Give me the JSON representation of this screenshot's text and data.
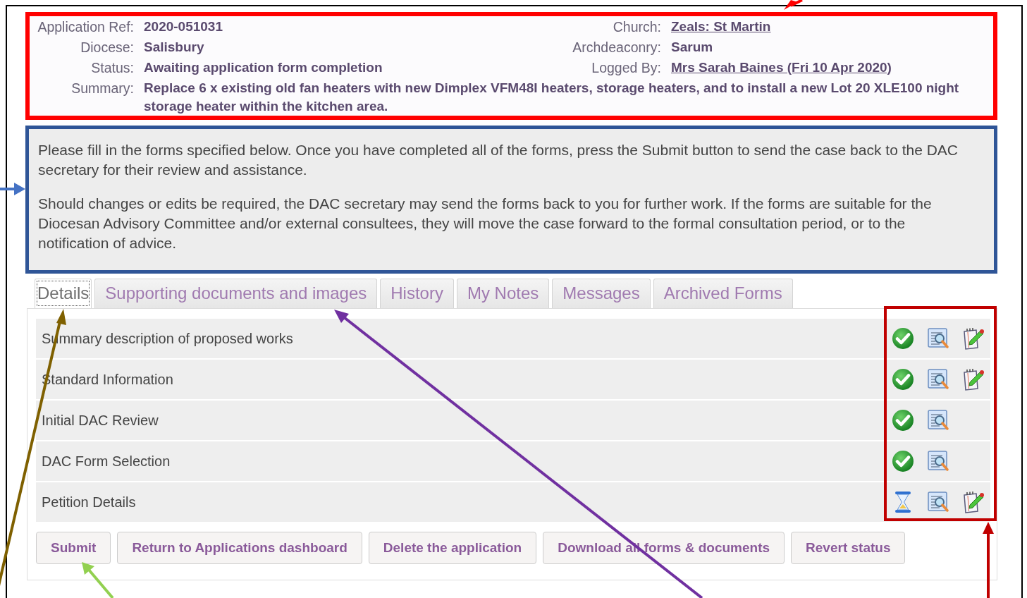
{
  "info": {
    "left": [
      {
        "label": "Application Ref:",
        "value": "2020-051031",
        "link": false
      },
      {
        "label": "Diocese:",
        "value": "Salisbury",
        "link": false
      },
      {
        "label": "Status:",
        "value": "Awaiting application form completion",
        "link": false
      }
    ],
    "right": [
      {
        "label": "Church:",
        "value": "Zeals: St Martin",
        "link": true
      },
      {
        "label": "Archdeaconry:",
        "value": "Sarum",
        "link": false
      },
      {
        "label": "Logged By:",
        "value": "Mrs Sarah Baines (Fri 10 Apr 2020)",
        "link": true
      }
    ],
    "summary": {
      "label": "Summary:",
      "value": "Replace 6 x existing old fan heaters with new Dimplex VFM48I heaters, storage heaters, and to install a new Lot 20 XLE100 night storage heater within the kitchen area."
    }
  },
  "instructions": [
    "Please fill in the forms specified below. Once you have completed all of the forms, press the Submit button to send the case back to the DAC secretary for their review and assistance.",
    "Should changes or edits be required, the DAC secretary may send the forms back to you for further work. If the forms are suitable for the Diocesan Advisory Committee and/or external consultees, they will move the case forward to the formal consultation period, or to the notification of advice."
  ],
  "tabs": [
    {
      "label": "Details",
      "selected": true
    },
    {
      "label": "Supporting documents and images",
      "selected": false
    },
    {
      "label": "History",
      "selected": false
    },
    {
      "label": "My Notes",
      "selected": false
    },
    {
      "label": "Messages",
      "selected": false
    },
    {
      "label": "Archived Forms",
      "selected": false
    }
  ],
  "forms": [
    {
      "name": "Summary description of proposed works",
      "done": true,
      "editable": true
    },
    {
      "name": "Standard Information",
      "done": true,
      "editable": true
    },
    {
      "name": "Initial DAC Review",
      "done": true,
      "editable": false
    },
    {
      "name": "DAC Form Selection",
      "done": true,
      "editable": false
    },
    {
      "name": "Petition Details",
      "done": false,
      "editable": true
    }
  ],
  "buttons": [
    "Submit",
    "Return to Applications dashboard",
    "Delete the application",
    "Download all forms & documents",
    "Revert status"
  ]
}
